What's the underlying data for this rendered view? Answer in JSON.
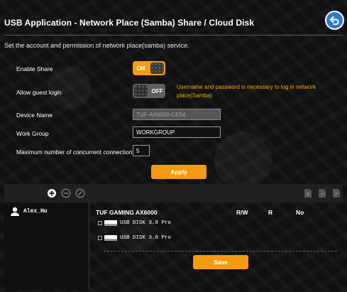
{
  "header": {
    "title": "USB Application - Network Place (Samba) Share / Cloud Disk",
    "subtitle": "Set the account and permission of network place(samba) service."
  },
  "settings": {
    "enable_share": {
      "label": "Enable Share",
      "state": "ON"
    },
    "guest_login": {
      "label": "Allow guest login",
      "state": "OFF",
      "warning": "Username and password is necessary to log in network place(Samba)"
    },
    "device_name": {
      "label": "Device Name",
      "value": "TUF-AX6000-CE54"
    },
    "work_group": {
      "label": "Work Group",
      "value": "WORKGROUP"
    },
    "max_connections": {
      "label": "Maximum number of concurrent connections",
      "value": "5"
    },
    "apply_label": "Apply"
  },
  "accounts": {
    "users": [
      {
        "name": "Alex_Hu"
      }
    ]
  },
  "permissions": {
    "device": "TUF GAMING AX6000",
    "columns": [
      "R/W",
      "R",
      "No"
    ],
    "disks": [
      {
        "label": "USB DISK 3.0 Pro"
      },
      {
        "label": "USB DISK 3.0 Pro"
      }
    ],
    "save_label": "Save"
  },
  "colors": {
    "accent": "#f39c12",
    "back_button": "#2d7ad6",
    "warning": "#f3a712"
  }
}
